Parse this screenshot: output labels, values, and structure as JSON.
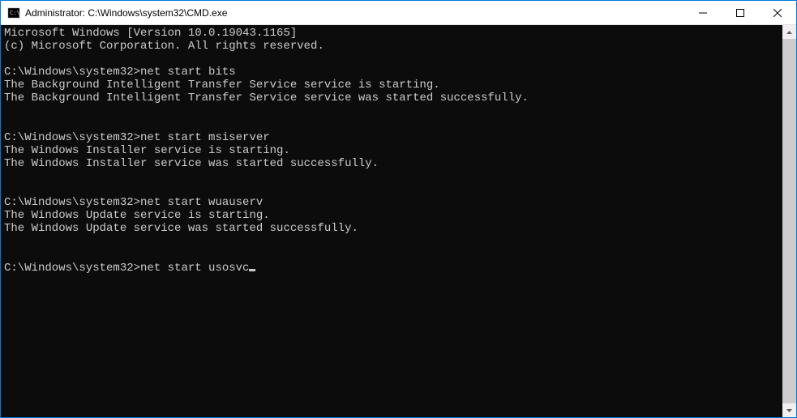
{
  "titlebar": {
    "title": "Administrator: C:\\Windows\\system32\\CMD.exe"
  },
  "terminal": {
    "banner_line1": "Microsoft Windows [Version 10.0.19043.1165]",
    "banner_line2": "(c) Microsoft Corporation. All rights reserved.",
    "prompt": "C:\\Windows\\system32>",
    "blocks": [
      {
        "command": "net start bits",
        "output1": "The Background Intelligent Transfer Service service is starting.",
        "output2": "The Background Intelligent Transfer Service service was started successfully."
      },
      {
        "command": "net start msiserver",
        "output1": "The Windows Installer service is starting.",
        "output2": "The Windows Installer service was started successfully."
      },
      {
        "command": "net start wuauserv",
        "output1": "The Windows Update service is starting.",
        "output2": "The Windows Update service was started successfully."
      }
    ],
    "current_command": "net start usosvc"
  }
}
